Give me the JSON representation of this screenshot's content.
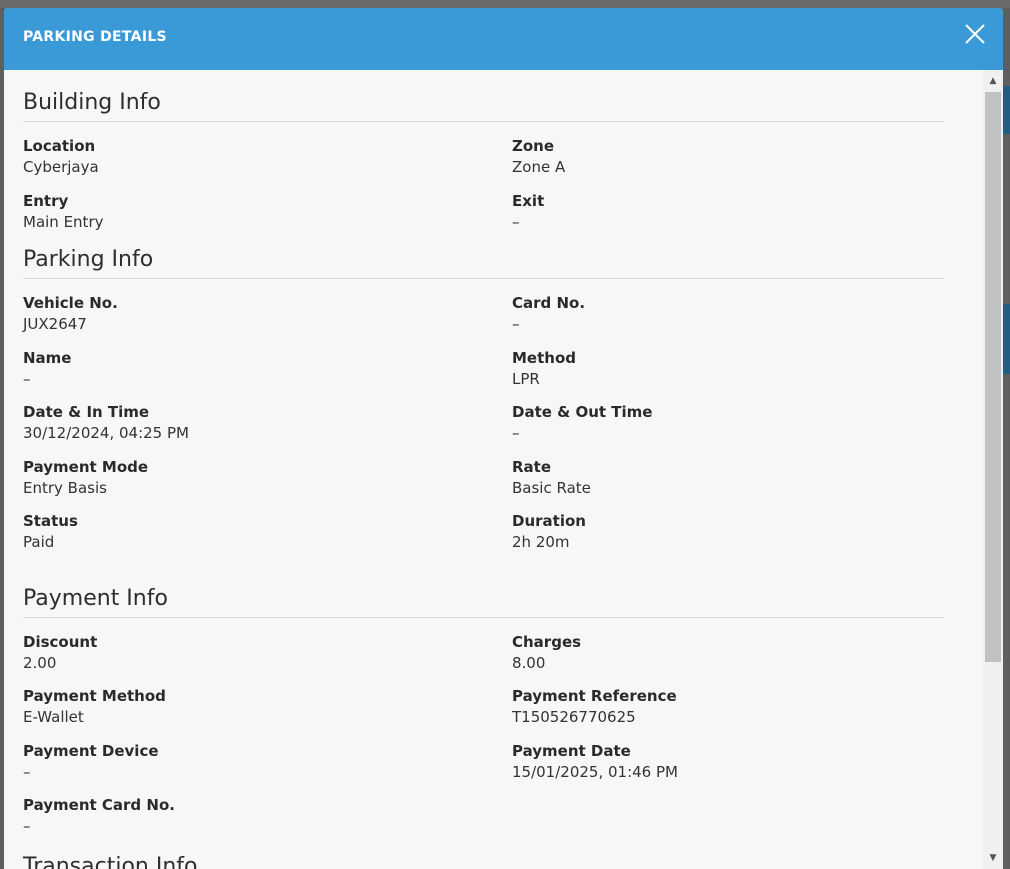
{
  "modal": {
    "title": "PARKING DETAILS",
    "close_icon": "close-icon"
  },
  "building": {
    "title": "Building Info",
    "fields": [
      {
        "label": "Location",
        "value": "Cyberjaya"
      },
      {
        "label": "Zone",
        "value": "Zone A"
      },
      {
        "label": "Entry",
        "value": "Main Entry"
      },
      {
        "label": "Exit",
        "value": "–"
      }
    ]
  },
  "parking": {
    "title": "Parking Info",
    "fields": [
      {
        "label": "Vehicle No.",
        "value": "JUX2647"
      },
      {
        "label": "Card No.",
        "value": "–"
      },
      {
        "label": "Name",
        "value": "–"
      },
      {
        "label": "Method",
        "value": "LPR"
      },
      {
        "label": "Date & In Time",
        "value": "30/12/2024, 04:25 PM"
      },
      {
        "label": "Date & Out Time",
        "value": "–"
      },
      {
        "label": "Payment Mode",
        "value": "Entry Basis"
      },
      {
        "label": "Rate",
        "value": "Basic Rate"
      },
      {
        "label": "Status",
        "value": "Paid"
      },
      {
        "label": "Duration",
        "value": "2h 20m"
      }
    ]
  },
  "payment": {
    "title": "Payment Info",
    "fields": [
      {
        "label": "Discount",
        "value": "2.00"
      },
      {
        "label": "Charges",
        "value": "8.00"
      },
      {
        "label": "Payment Method",
        "value": "E-Wallet"
      },
      {
        "label": "Payment Reference",
        "value": "T150526770625"
      },
      {
        "label": "Payment Device",
        "value": "–"
      },
      {
        "label": "Payment Date",
        "value": "15/01/2025, 01:46 PM"
      },
      {
        "label": "Payment Card No.",
        "value": "–"
      }
    ]
  },
  "transaction": {
    "title": "Transaction Info"
  },
  "colors": {
    "header": "#3a9ad8",
    "body_bg": "#f7f7f7"
  }
}
